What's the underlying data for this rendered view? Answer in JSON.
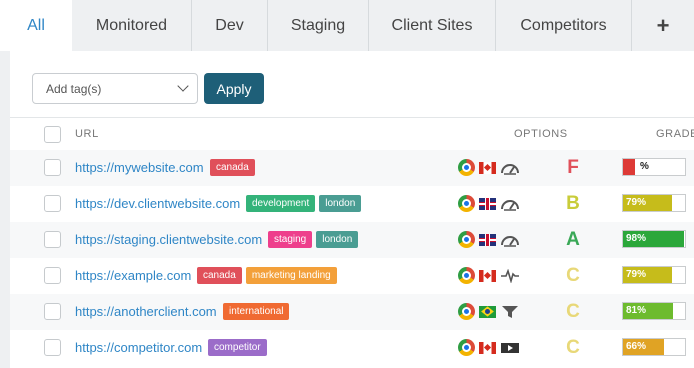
{
  "tabs": [
    {
      "label": "All",
      "active": true
    },
    {
      "label": "Monitored",
      "active": false
    },
    {
      "label": "Dev",
      "active": false
    },
    {
      "label": "Staging",
      "active": false
    },
    {
      "label": "Client Sites",
      "active": false
    },
    {
      "label": "Competitors",
      "active": false
    },
    {
      "label": "+",
      "active": false
    }
  ],
  "toolbar": {
    "tag_select_value": "Add tag(s)",
    "apply_label": "Apply"
  },
  "table": {
    "columns": {
      "url": "URL",
      "options": "OPTIONS",
      "grade": "GRADE"
    },
    "rows": [
      {
        "url": "https://mywebsite.com",
        "tags": [
          {
            "label": "canada",
            "color": "#e0505a"
          }
        ],
        "options": [
          "chrome-icon",
          "canada-flag-icon",
          "gauge-icon"
        ],
        "grade": "F",
        "grade_color": "#e0505a",
        "score": 20,
        "score_label": "%",
        "bar_color": "#dd3a36"
      },
      {
        "url": "https://dev.clientwebsite.com",
        "tags": [
          {
            "label": "development",
            "color": "#34b37a"
          },
          {
            "label": "london",
            "color": "#4a9d93"
          }
        ],
        "options": [
          "chrome-icon",
          "uk-flag-icon",
          "gauge-icon"
        ],
        "grade": "B",
        "grade_color": "#c9cc3a",
        "score": 79,
        "score_label": "79%",
        "bar_color": "#c6bc1b"
      },
      {
        "url": "https://staging.clientwebsite.com",
        "tags": [
          {
            "label": "staging",
            "color": "#ee3f8c"
          },
          {
            "label": "london",
            "color": "#4a9d93"
          }
        ],
        "options": [
          "chrome-icon",
          "uk-flag-icon",
          "gauge-icon"
        ],
        "grade": "A",
        "grade_color": "#3aa857",
        "score": 98,
        "score_label": "98%",
        "bar_color": "#2ba73a"
      },
      {
        "url": "https://example.com",
        "tags": [
          {
            "label": "canada",
            "color": "#e0505a"
          },
          {
            "label": "marketing landing",
            "color": "#f3a03a"
          }
        ],
        "options": [
          "chrome-icon",
          "canada-flag-icon",
          "heartbeat-icon"
        ],
        "grade": "C",
        "grade_color": "#e8d878",
        "score": 79,
        "score_label": "79%",
        "bar_color": "#c6bc1b"
      },
      {
        "url": "https://anotherclient.com",
        "tags": [
          {
            "label": "international",
            "color": "#f06a32"
          }
        ],
        "options": [
          "chrome-icon",
          "brazil-flag-icon",
          "filter-icon"
        ],
        "grade": "C",
        "grade_color": "#e8d878",
        "score": 81,
        "score_label": "81%",
        "bar_color": "#6dbb2e"
      },
      {
        "url": "https://competitor.com",
        "tags": [
          {
            "label": "competitor",
            "color": "#9b6cc9"
          }
        ],
        "options": [
          "chrome-icon",
          "canada-flag-icon",
          "video-icon"
        ],
        "grade": "C",
        "grade_color": "#e8d878",
        "score": 66,
        "score_label": "66%",
        "bar_color": "#e0a324"
      }
    ]
  }
}
